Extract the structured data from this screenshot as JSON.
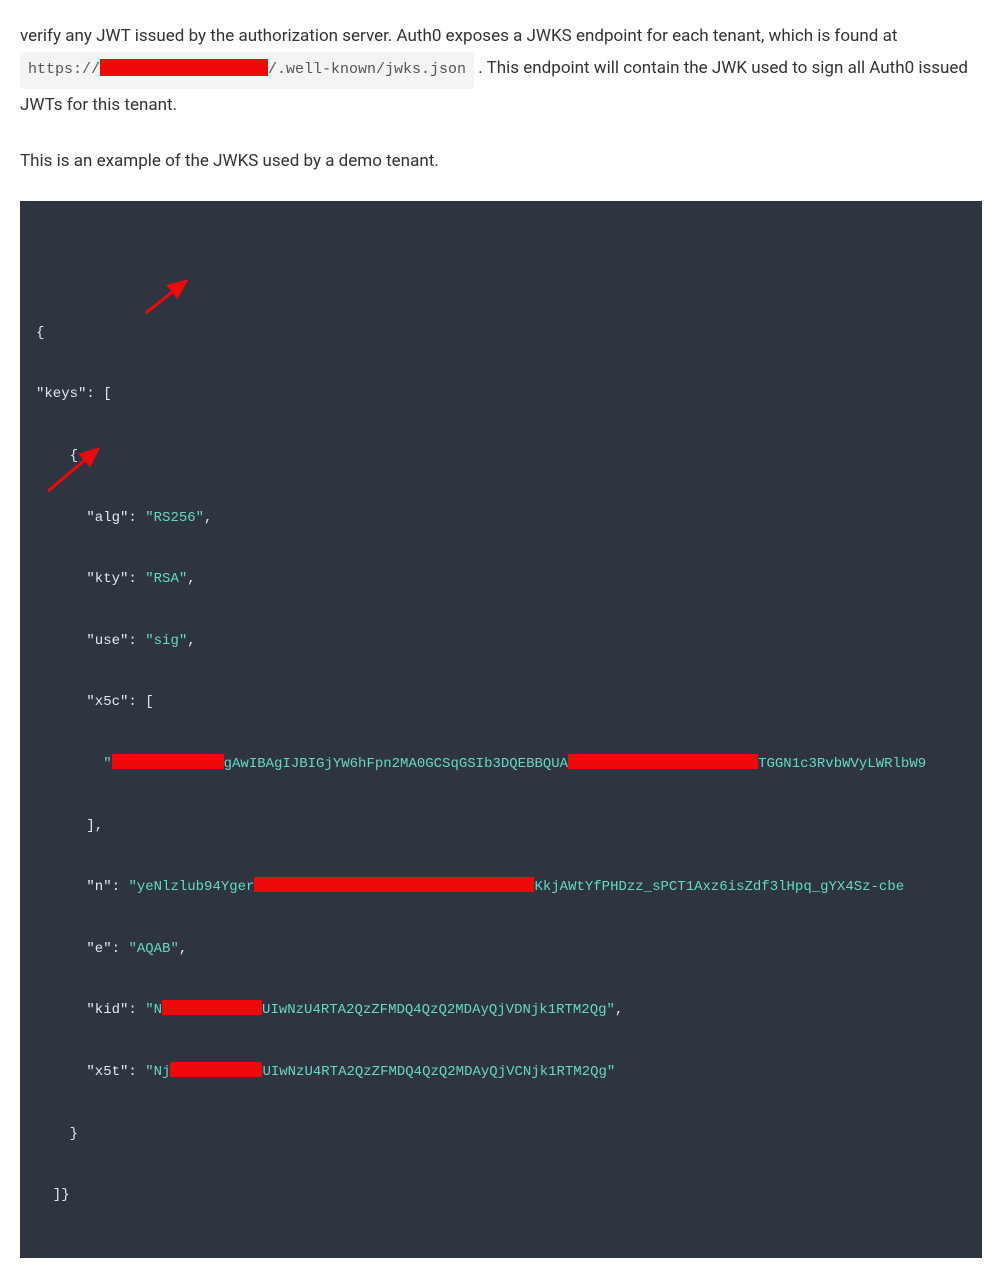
{
  "para1": {
    "text_before_code": "verify any JWT issued by the authorization server. Auth0 exposes a JWKS endpoint for each tenant, which is found at ",
    "code_prefix": "https://",
    "code_redacted": "[REDACTED]",
    "code_suffix": "/.well-known/jwks.json",
    "text_after_code": ". This endpoint will contain the JWK used to sign all Auth0 issued JWTs for this tenant."
  },
  "para2": {
    "text": "This is an example of the JWKS used by a demo tenant."
  },
  "code": {
    "open_brace": "{",
    "keys_key": "\"keys\"",
    "keys_open": ": [",
    "inner_open": "    {",
    "alg_key": "      \"alg\"",
    "alg_val": "\"RS256\"",
    "comma": ",",
    "kty_key": "      \"kty\"",
    "kty_val": "\"RSA\"",
    "use_key": "      \"use\"",
    "use_val": "\"sig\"",
    "x5c_key": "      \"x5c\"",
    "x5c_open": ": [",
    "x5c_quote": "        \"",
    "x5c_mid1": "gAwIBAgIJBIGjYW6hFpn2MA0GCSqGSIb3DQEBBQUA",
    "x5c_mid2": "TGGN1c3RvbWVyLWRlbW9",
    "x5c_close_arr": "      ],",
    "n_key": "      \"n\"",
    "n_pre": "\"yeNlzlub94Yger",
    "n_mid": "KkjAWtYfPHDzz_sPCT1Axz6isZdf3lHpq_gYX4Sz-cbe",
    "e_key": "      \"e\"",
    "e_val": "\"AQAB\"",
    "kid_key": "      \"kid\"",
    "kid_pre": "\"N",
    "kid_suf": "UIwNzU4RTA2QzZFMDQ4QzQ2MDAyQjVDNjk1RTM2Qg\"",
    "x5t_key": "      \"x5t\"",
    "x5t_pre": "\"Nj",
    "x5t_suf": "UIwNzU4RTA2QzZFMDQ4QzQ2MDAyQjVCNjk1RTM2Qg\"",
    "inner_close": "    }",
    "keys_close": "  ]}",
    "colon_space": ": "
  }
}
